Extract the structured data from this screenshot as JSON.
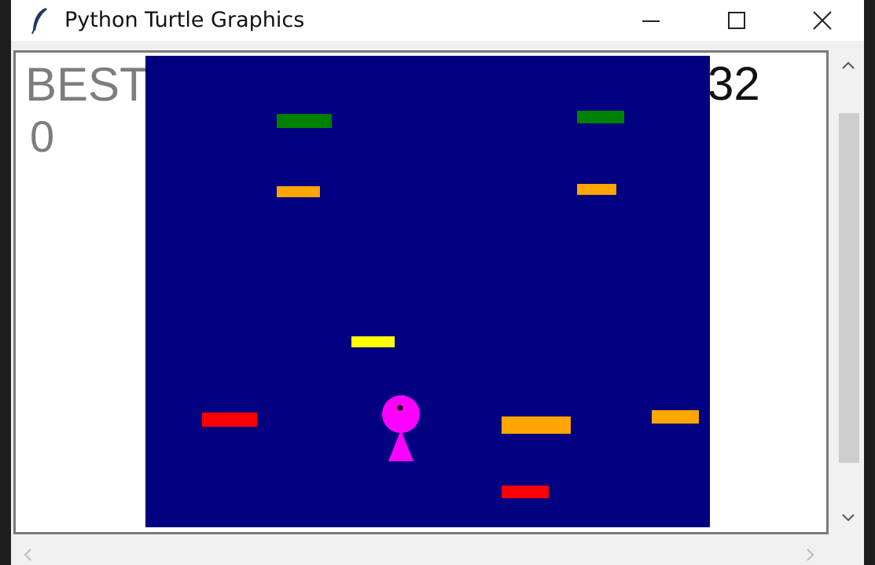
{
  "window": {
    "title": "Python Turtle Graphics",
    "icon": "feather-icon",
    "controls": [
      "minimize-icon",
      "maximize-icon",
      "close-icon"
    ]
  },
  "hud": {
    "best_label": "BEST",
    "best_value": "0",
    "score_value": "32"
  },
  "colors": {
    "playfield": "#000080",
    "green": "#008000",
    "orange": "#ffa500",
    "yellow": "#ffff00",
    "red": "#ff0000",
    "player": "#ff00ff",
    "label_gray": "#7d7d7d"
  },
  "platforms": [
    {
      "color": "green"
    },
    {
      "color": "green"
    },
    {
      "color": "orange"
    },
    {
      "color": "orange"
    },
    {
      "color": "yellow"
    },
    {
      "color": "red"
    },
    {
      "color": "orange"
    },
    {
      "color": "orange"
    },
    {
      "color": "red"
    }
  ],
  "player": {
    "shape": "magenta-ball-on-triangle"
  },
  "scrollbars": {
    "vertical": true,
    "horizontal": true
  }
}
